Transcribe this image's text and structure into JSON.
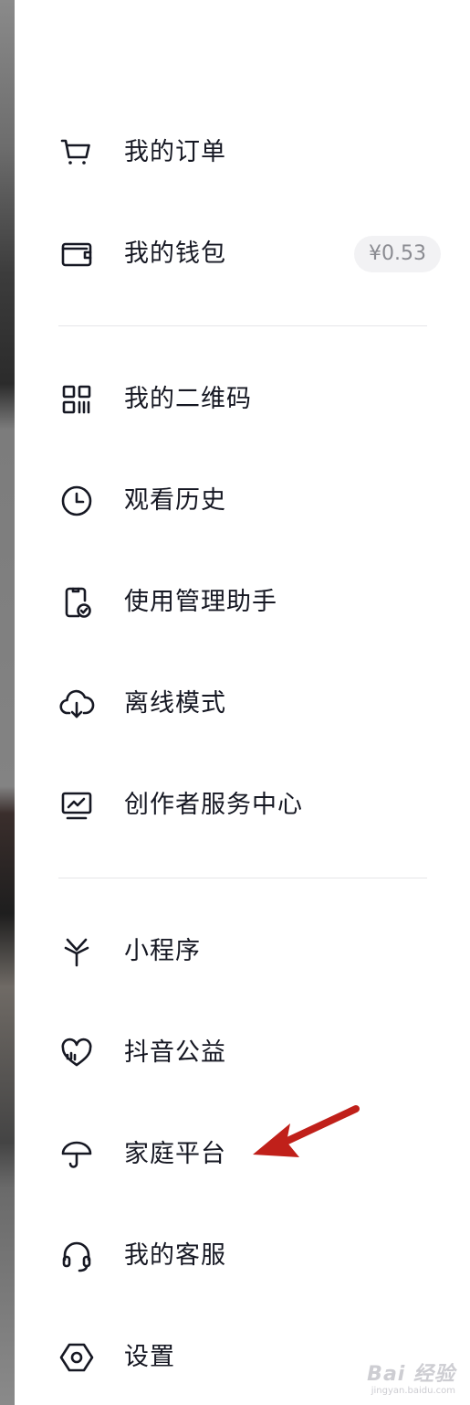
{
  "menu": {
    "orders": {
      "label": "我的订单",
      "icon": "cart-icon"
    },
    "wallet": {
      "label": "我的钱包",
      "icon": "wallet-icon",
      "balance": "¥0.53"
    },
    "qrcode": {
      "label": "我的二维码",
      "icon": "qrcode-icon"
    },
    "history": {
      "label": "观看历史",
      "icon": "clock-icon"
    },
    "usage_assistant": {
      "label": "使用管理助手",
      "icon": "phone-check-icon"
    },
    "offline": {
      "label": "离线模式",
      "icon": "cloud-download-icon"
    },
    "creator_center": {
      "label": "创作者服务中心",
      "icon": "monitor-chart-icon"
    },
    "mini_programs": {
      "label": "小程序",
      "icon": "asterisk-icon"
    },
    "charity": {
      "label": "抖音公益",
      "icon": "heart-icon"
    },
    "family": {
      "label": "家庭平台",
      "icon": "umbrella-icon"
    },
    "customer_service": {
      "label": "我的客服",
      "icon": "headset-icon"
    },
    "settings": {
      "label": "设置",
      "icon": "hexagon-gear-icon"
    }
  },
  "watermark": {
    "main": "Bai 经验",
    "sub": "jingyan.baidu.com"
  },
  "colors": {
    "text": "#161823",
    "icon": "#161823",
    "badge_bg": "#f2f2f4",
    "badge_text": "#8a8b91",
    "divider": "#e6e6e8",
    "arrow": "#c0201a"
  }
}
